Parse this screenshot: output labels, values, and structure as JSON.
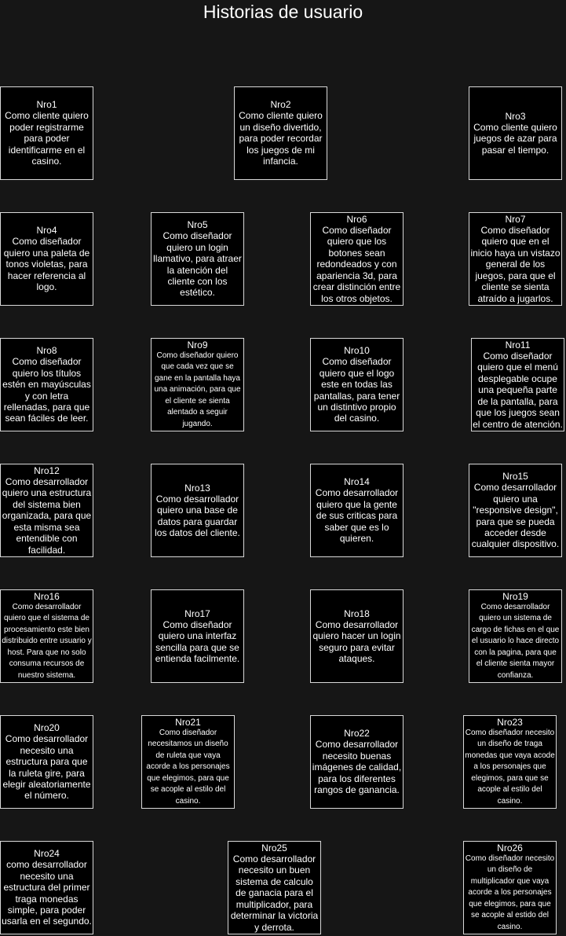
{
  "title": "Historias de usuario",
  "stories": [
    {
      "id": "Nro1",
      "text": "Como cliente quiero poder registrarme para poder identificarme en el casino."
    },
    {
      "id": "Nro2",
      "text": "Como cliente quiero un diseño divertido, para poder recordar los juegos de mi infancia."
    },
    {
      "id": "Nro3",
      "text": "Como cliente quiero juegos de azar para pasar el tiempo."
    },
    {
      "id": "Nro4",
      "text": "Como diseñador quiero una paleta de tonos violetas, para hacer referencia al logo."
    },
    {
      "id": "Nro5",
      "text": "Como diseñador quiero un login llamativo, para atraer la atención del cliente con los estético."
    },
    {
      "id": "Nro6",
      "text": "Como diseñador quiero que los botones sean redondeados y con apariencia 3d, para crear distinción entre los otros objetos."
    },
    {
      "id": "Nro7",
      "text": "Como diseñador quiero que en el inicio haya un vistazo general de los juegos, para que el cliente se sienta atraído a jugarlos."
    },
    {
      "id": "Nro8",
      "text": "Como diseñador quiero los títulos estén en mayúsculas y con letra rellenadas, para que sean fáciles de leer."
    },
    {
      "id": "Nro9",
      "text": "Como diseñador quiero que cada vez que se gane en la pantalla haya una animación, para que el cliente se sienta alentado a seguir jugando."
    },
    {
      "id": "Nro10",
      "text": "Como diseñador quiero que el logo este en todas las pantallas, para tener un distintivo propio del casino."
    },
    {
      "id": "Nro11",
      "text": "Como diseñador quiero que el menú desplegable ocupe una pequeña parte de la pantalla, para que los juegos sean el centro de atención."
    },
    {
      "id": "Nro12",
      "text": "Como desarrollador quiero una estructura del sistema bien organizada, para que esta misma sea entendible con facilidad."
    },
    {
      "id": "Nro13",
      "text": "Como desarrollador quiero una base de datos para guardar los datos del cliente."
    },
    {
      "id": "Nro14",
      "text": "Como desarrollador quiero que la gente de sus criticas para saber que es lo quieren."
    },
    {
      "id": "Nro15",
      "text": "Como desarrollador quiero una \"responsive design\", para que se pueda acceder desde cualquier dispositivo."
    },
    {
      "id": "Nro16",
      "text": "Como desarrollador quiero que el sistema de procesamiento este bien distribuido entre usuario y host. Para que no solo consuma recursos de nuestro sistema."
    },
    {
      "id": "Nro17",
      "text": "Como diseñador quiero una interfaz sencilla para que se entienda facilmente."
    },
    {
      "id": "Nro18",
      "text": "Como desarrollador quiero hacer un login seguro para evitar ataques."
    },
    {
      "id": "Nro19",
      "text": "Como desarrollador quiero un sistema de cargo de fichas en el que el usuario lo hace directo con la pagina, para que el cliente sienta mayor confianza."
    },
    {
      "id": "Nro20",
      "text": "Como desarrollador necesito una estructura para que la ruleta gire, para elegir aleatoriamente el número."
    },
    {
      "id": "Nro21",
      "text": "Como diseñador necesitamos un diseño de ruleta que vaya acorde a los personajes que elegimos, para que se acople al estilo del casino."
    },
    {
      "id": "Nro22",
      "text": "Como desarrollador necesito buenas imágenes de calidad, para los diferentes rangos de ganancia."
    },
    {
      "id": "Nro23",
      "text": "Como diseñador necesito un diseño de traga monedas que vaya acode a los personajes que elegimos, para que se acople al estilo del casino."
    },
    {
      "id": "Nro24",
      "text": "como desarrollador necesito una estructura del primer traga monedas simple, para poder usarla en el segundo."
    },
    {
      "id": "Nro25",
      "text": "Como desarrollador necesito un buen sistema de calculo de ganacia para el multiplicador, para determinar  la victoria y derrota."
    },
    {
      "id": "Nro26",
      "text": "Como diseñador necesito un diseño de multiplicador que vaya acorde a los personajes que elegimos, para que se acople al estido del casino."
    }
  ]
}
